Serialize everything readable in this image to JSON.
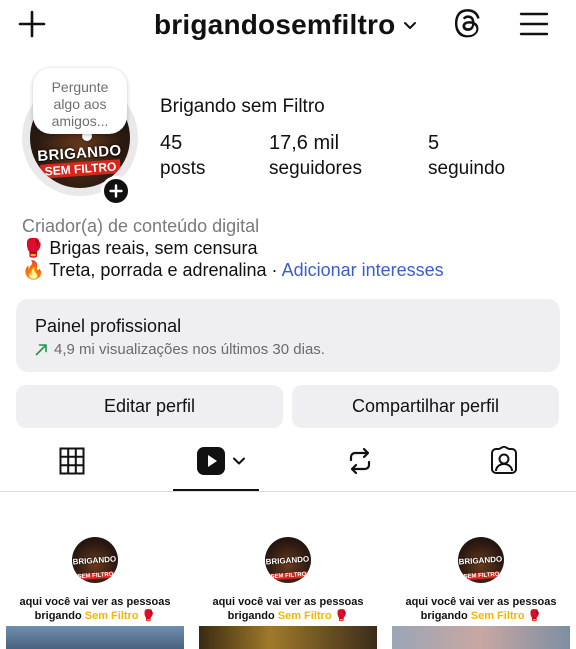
{
  "topbar": {
    "username": "brigandosemfiltro"
  },
  "profile": {
    "note_bubble": [
      "Pergunte",
      "algo aos",
      "amigos..."
    ],
    "avatar_text": [
      "BRIGANDO",
      "SEM FILTRO"
    ],
    "display_name": "Brigando sem Filtro",
    "stats": [
      {
        "value": "45",
        "label": "posts"
      },
      {
        "value": "17,6 mil",
        "label": "seguidores"
      },
      {
        "value": "5",
        "label": "seguindo"
      }
    ],
    "category": "Criador(a) de conteúdo digital",
    "bio_line1": "🥊 Brigas reais, sem censura",
    "bio_line2": "🔥 Treta, porrada e adrenalina · ",
    "bio_link": "Adicionar interesses"
  },
  "panel": {
    "title": "Painel profissional",
    "subtitle": "4,9 mi visualizações nos últimos 30 dias."
  },
  "buttons": {
    "edit": "Editar perfil",
    "share": "Compartilhar perfil"
  },
  "tabs": [
    "grid",
    "reels",
    "reposts",
    "tagged"
  ],
  "reels": [
    {
      "logo": [
        "BRIGANDO",
        "SEM FILTRO"
      ],
      "line1": "aqui você vai ver as pessoas",
      "line2a": "brigando ",
      "line2b": "Sem Filtro",
      "line2c": " 🥊",
      "thumb": "#4f6f8f"
    },
    {
      "logo": [
        "BRIGANDO",
        "SEM FILTRO"
      ],
      "line1": "aqui você vai ver as pessoas",
      "line2a": "brigando ",
      "line2b": "Sem Filtro",
      "line2c": " 🥊",
      "thumb": "#6b5a2a"
    },
    {
      "logo": [
        "BRIGANDO",
        "SEM FILTRO"
      ],
      "line1": "aqui você vai ver as pessoas",
      "line2a": "brigando ",
      "line2b": "Sem Filtro",
      "line2c": " 🥊",
      "thumb": "#8a9aae"
    }
  ],
  "colors": {
    "link": "#3a5ecf",
    "badge_red": "#d9261c",
    "highlight_yellow": "#f2b705",
    "panel_bg": "#efeff2"
  }
}
